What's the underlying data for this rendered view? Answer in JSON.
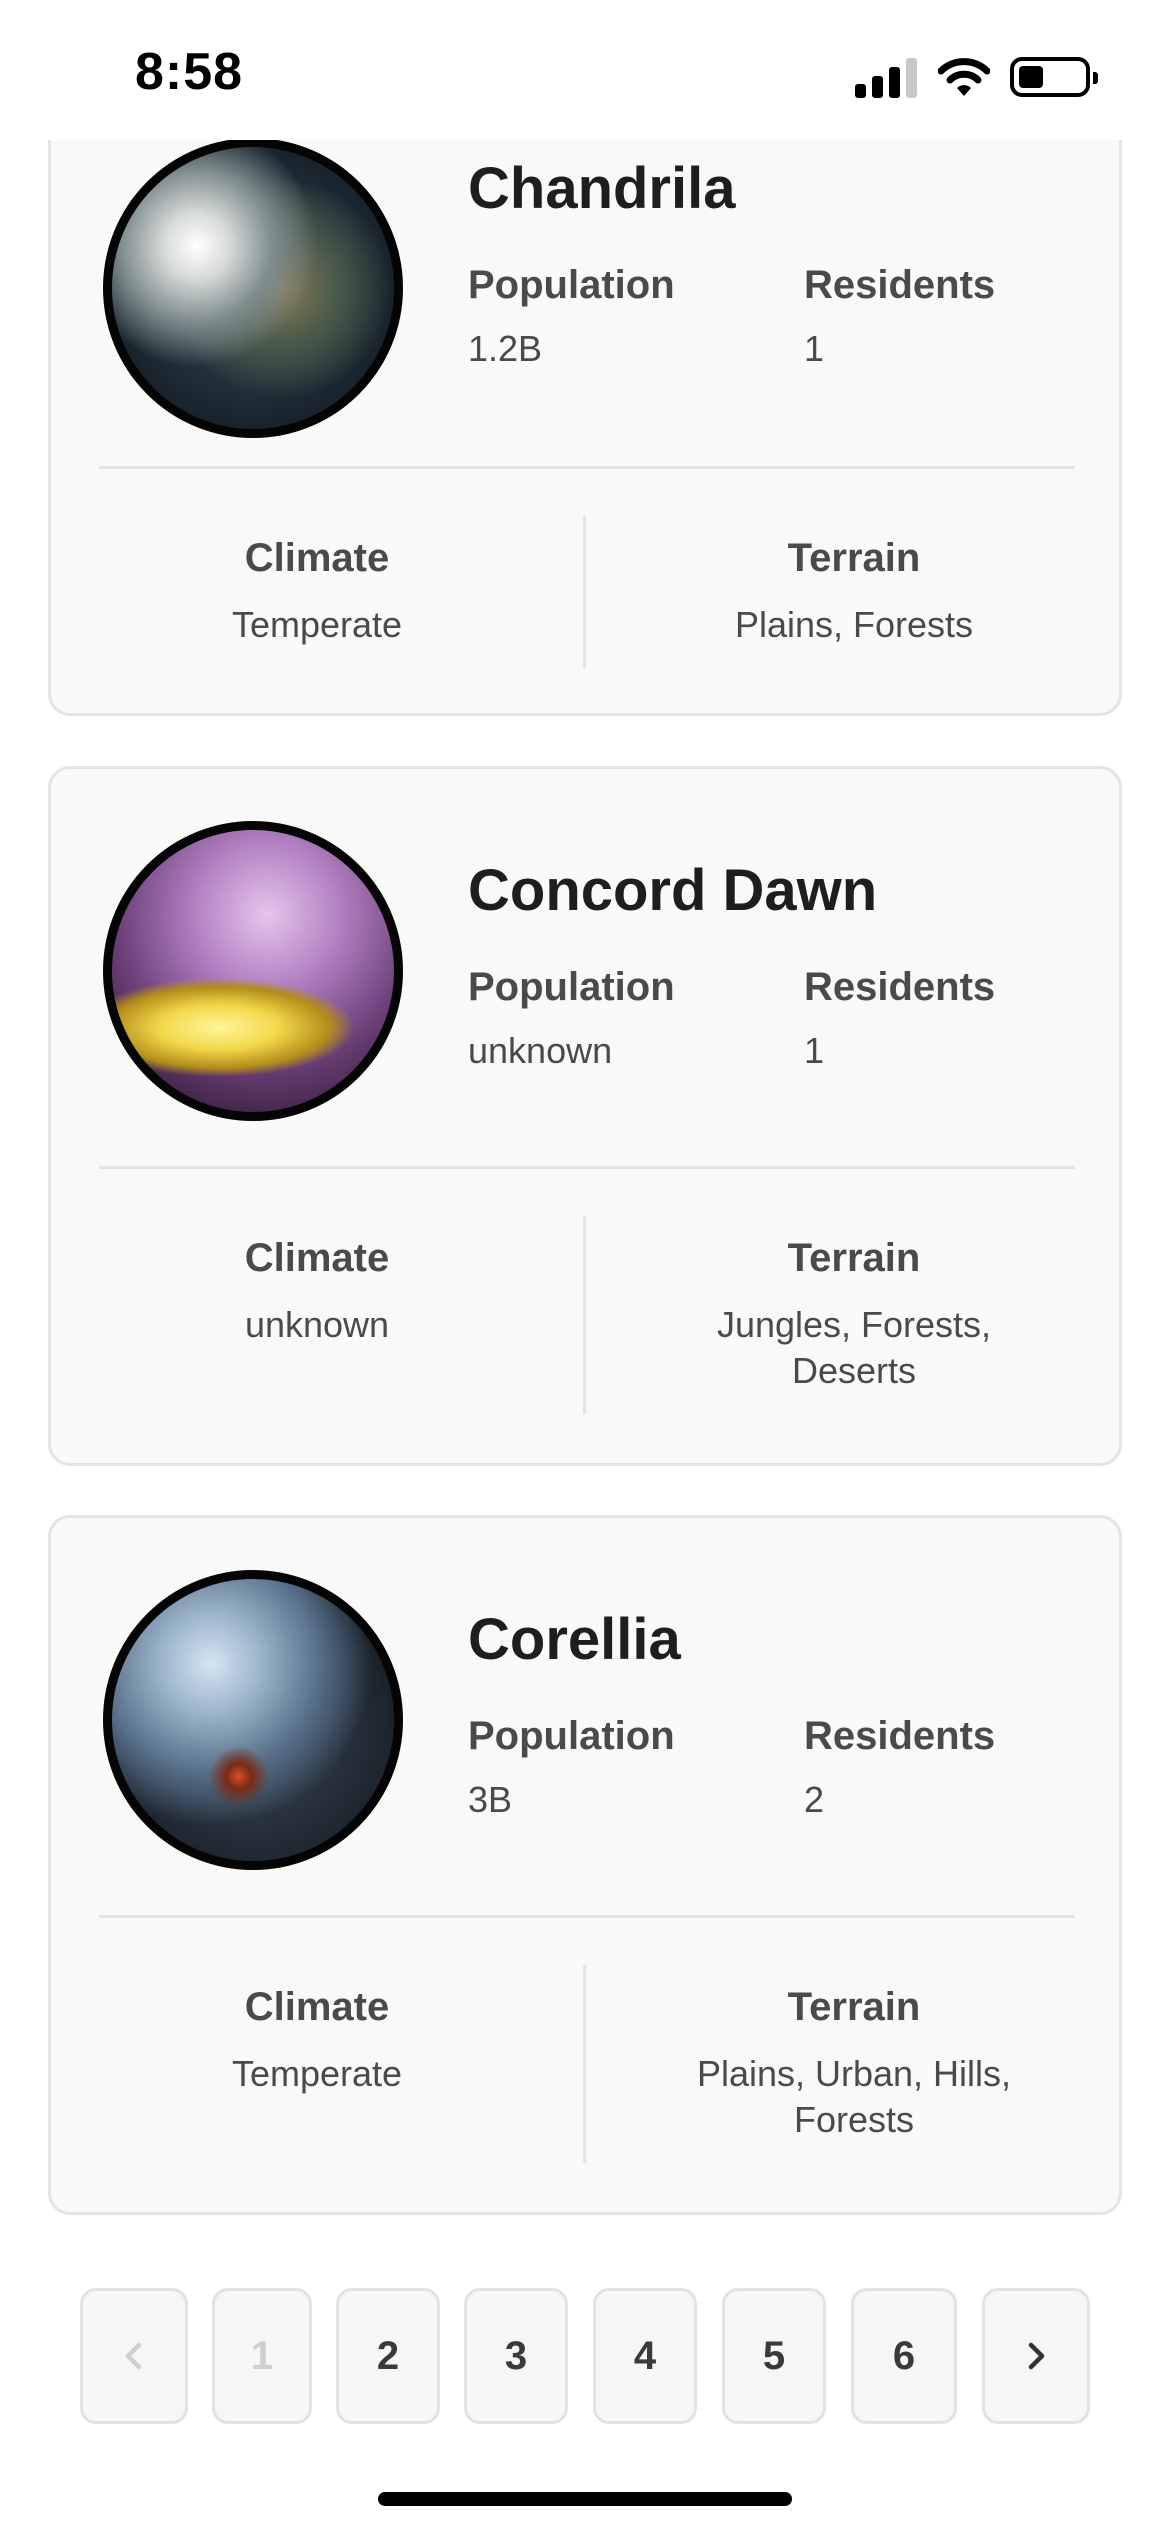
{
  "status_bar": {
    "time": "8:58"
  },
  "planets": [
    {
      "name": "Chandrila",
      "population_label": "Population",
      "population": "1.2B",
      "residents_label": "Residents",
      "residents": "1",
      "climate_label": "Climate",
      "climate": "Temperate",
      "terrain_label": "Terrain",
      "terrain": "Plains, Forests"
    },
    {
      "name": "Concord Dawn",
      "population_label": "Population",
      "population": "unknown",
      "residents_label": "Residents",
      "residents": "1",
      "climate_label": "Climate",
      "climate": "unknown",
      "terrain_label": "Terrain",
      "terrain": "Jungles, Forests, Deserts"
    },
    {
      "name": "Corellia",
      "population_label": "Population",
      "population": "3B",
      "residents_label": "Residents",
      "residents": "2",
      "climate_label": "Climate",
      "climate": "Temperate",
      "terrain_label": "Terrain",
      "terrain": "Plains, Urban, Hills, Forests"
    }
  ],
  "pagination": {
    "prev_icon": "chevron-left-icon",
    "pages": [
      "1",
      "2",
      "3",
      "4",
      "5",
      "6"
    ],
    "current_page": "1",
    "next_icon": "chevron-right-icon"
  },
  "colors": {
    "card_background": "#f9f9f8",
    "card_border": "#e4e4e2",
    "text_primary": "#1e1e1e",
    "text_secondary": "#4a4a4a"
  }
}
